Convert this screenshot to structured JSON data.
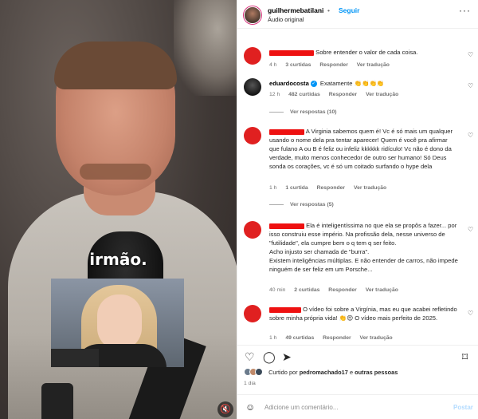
{
  "video": {
    "caption": "irmão.",
    "mute_icon": "speaker-muted-icon"
  },
  "header": {
    "username": "guilhermebatilani",
    "separator": "•",
    "follow_label": "Seguir",
    "audio_label": "Áudio original",
    "more_icon": "more-options-icon"
  },
  "comments": [
    {
      "text": "Sobre entender o valor de cada coisa.",
      "time": "4 h",
      "likes": "3 curtidas",
      "reply": "Responder",
      "translate": "Ver tradução"
    },
    {
      "user": "eduardocosta",
      "text": "Exatamente 👏👏👏👏",
      "time": "12 h",
      "likes": "482 curtidas",
      "reply": "Responder",
      "translate": "Ver tradução",
      "replies": "Ver respostas (10)"
    },
    {
      "text": "A Virginia sabemos quem é! Vc é só mais um qualquer usando o nome dela pra tentar aparecer! Quem é você pra afirmar que fulano A ou B é feliz ou infeliz kkkkkk ridículo! Vc não é dono da verdade, muito menos conhecedor de outro ser humano! Só Deus sonda os corações, vc é só um coitado surfando o hype dela",
      "time": "1 h",
      "likes": "1 curtida",
      "reply": "Responder",
      "translate": "Ver tradução",
      "replies": "Ver respostas (5)"
    },
    {
      "text_1": "Ela é inteligentíssima no que ela se propôs a fazer... por isso construiu esse império. Na profissão dela, nesse universo de \"futilidade\", ela cumpre bem o q tem q ser feito.",
      "text_2": "Acho injusto ser chamada de \"burra\".",
      "text_3": "Existem inteligências múltiplas. E não entender de carros, não impede ninguém de ser feliz em um Porsche...",
      "time": "40 min",
      "likes": "2 curtidas",
      "reply": "Responder",
      "translate": "Ver tradução"
    },
    {
      "text": "O vídeo foi sobre a Virgínia, mas eu que acabei refletindo sobre minha própria vida! 👏😍 O vídeo mais perfeito de 2025.",
      "time": "1 h",
      "likes": "49 curtidas",
      "reply": "Responder",
      "translate": "Ver tradução"
    }
  ],
  "actions": {
    "like_icon": "heart-icon",
    "comment_icon": "comment-icon",
    "share_icon": "send-icon",
    "save_icon": "bookmark-icon"
  },
  "liked_by": {
    "prefix": "Curtido por",
    "user": "pedromachado17",
    "suffix": "e",
    "others": "outras pessoas"
  },
  "post_date": "1 dia",
  "comment_box": {
    "placeholder": "Adicione um comentário...",
    "post_label": "Postar"
  },
  "colors": {
    "accent": "#0095f6",
    "redaction": "#e11111"
  }
}
